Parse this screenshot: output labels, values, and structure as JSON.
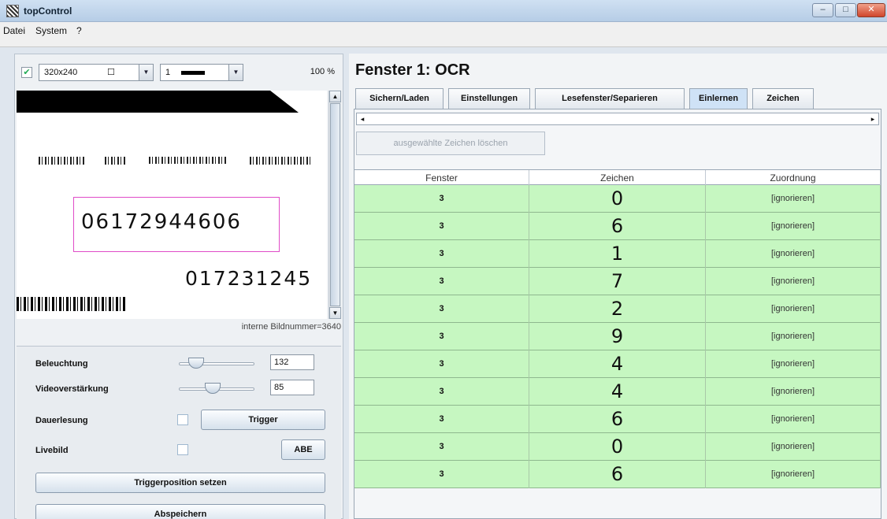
{
  "window": {
    "title": "topControl"
  },
  "window_controls": {
    "minimize": "–",
    "maximize": "□",
    "close": "✕"
  },
  "menu": {
    "items": [
      "Datei",
      "System",
      "?"
    ]
  },
  "left": {
    "checkbox_checked": true,
    "resolution": "320x240",
    "channel": "1",
    "zoom": "100 %",
    "image": {
      "label_main": "06172944606",
      "label_secondary": "017231245"
    },
    "frame_number": "interne Bildnummer=3640",
    "controls": {
      "illumination_label": "Beleuchtung",
      "illumination_value": "132",
      "illumination_level": 0.15,
      "gain_label": "Videoverstärkung",
      "gain_value": "85",
      "gain_level": 0.42,
      "continuous_label": "Dauerlesung",
      "trigger_button": "Trigger",
      "live_label": "Livebild",
      "abe_button": "ABE",
      "trigger_position_button": "Triggerposition setzen",
      "save_button": "Abspeichern"
    }
  },
  "right": {
    "title": "Fenster 1: OCR",
    "tabs": [
      "Sichern/Laden",
      "Einstellungen",
      "Lesefenster/Separieren",
      "Einlernen",
      "Zeichen"
    ],
    "active_tab": 3,
    "delete_button": "ausgewählte Zeichen löschen",
    "table": {
      "headers": [
        "Fenster",
        "Zeichen",
        "Zuordnung"
      ],
      "rows": [
        [
          "3",
          "0",
          "[ignorieren]"
        ],
        [
          "3",
          "6",
          "[ignorieren]"
        ],
        [
          "3",
          "1",
          "[ignorieren]"
        ],
        [
          "3",
          "7",
          "[ignorieren]"
        ],
        [
          "3",
          "2",
          "[ignorieren]"
        ],
        [
          "3",
          "9",
          "[ignorieren]"
        ],
        [
          "3",
          "4",
          "[ignorieren]"
        ],
        [
          "3",
          "4",
          "[ignorieren]"
        ],
        [
          "3",
          "6",
          "[ignorieren]"
        ],
        [
          "3",
          "0",
          "[ignorieren]"
        ],
        [
          "3",
          "6",
          "[ignorieren]"
        ]
      ]
    }
  }
}
